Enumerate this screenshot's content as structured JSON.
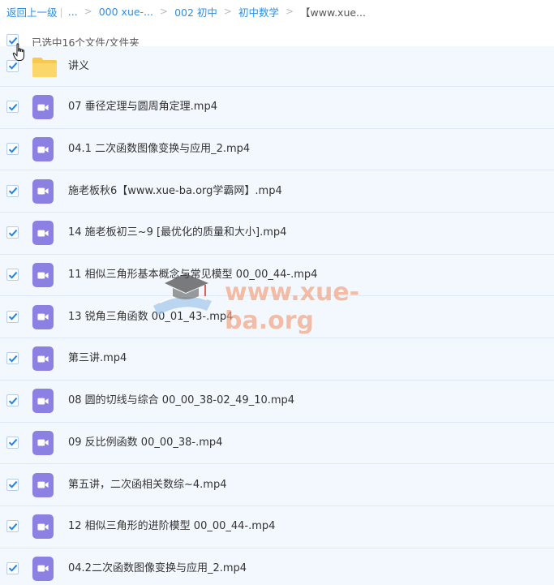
{
  "breadcrumb": {
    "back": "返回上一级",
    "ellipsis": "...",
    "items": [
      "000 xue-...",
      "002 初中",
      "初中数学",
      "【www.xue..."
    ],
    "separator": ">"
  },
  "selection": {
    "label": "已选中16个文件/文件夹",
    "checked": true
  },
  "files": [
    {
      "name": "讲义",
      "type": "folder"
    },
    {
      "name": "07 垂径定理与圆周角定理.mp4",
      "type": "video"
    },
    {
      "name": "04.1 二次函数图像变换与应用_2.mp4",
      "type": "video"
    },
    {
      "name": "施老板秋6【www.xue-ba.org学霸网】.mp4",
      "type": "video"
    },
    {
      "name": "14 施老板初三~9 [最优化的质量和大小].mp4",
      "type": "video"
    },
    {
      "name": "11 相似三角形基本概念与常见模型 00_00_44-.mp4",
      "type": "video"
    },
    {
      "name": "13 锐角三角函数 00_01_43-.mp4",
      "type": "video"
    },
    {
      "name": "第三讲.mp4",
      "type": "video"
    },
    {
      "name": "08 圆的切线与综合 00_00_38-02_49_10.mp4",
      "type": "video"
    },
    {
      "name": "09 反比例函数 00_00_38-.mp4",
      "type": "video"
    },
    {
      "name": "第五讲，二次函相关数综~4.mp4",
      "type": "video"
    },
    {
      "name": "12 相似三角形的进阶模型 00_00_44-.mp4",
      "type": "video"
    },
    {
      "name": "04.2二次函数图像变换与应用_2.mp4",
      "type": "video"
    }
  ],
  "watermark": {
    "text": "www.xue-ba.org"
  },
  "colors": {
    "link": "#2b8fe4",
    "row_bg": "#f3f8fe",
    "check": "#1e84e6",
    "video_icon": "#8d80e3",
    "folder": "#f8c94e"
  },
  "icons": {
    "video": "video-file-icon",
    "folder": "folder-icon",
    "check": "checkmark-icon",
    "cursor": "hand-cursor-icon"
  }
}
